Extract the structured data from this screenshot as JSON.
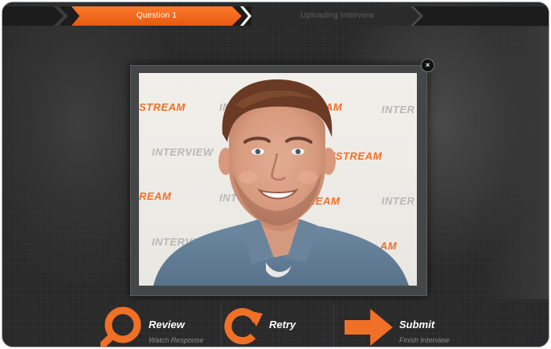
{
  "progress": {
    "steps": [
      {
        "label": "Question 1",
        "state": "active"
      },
      {
        "label": "Uploading Interview",
        "state": "pending"
      }
    ]
  },
  "video": {
    "watermarks": {
      "orange_stream": "STREAM",
      "orange_ream": "REAM",
      "orange_am": "AM",
      "orange_wstream": "WSTREAM",
      "gray_interview": "INTERVIEW",
      "gray_intervi": "INTERVI",
      "gray_inter": "INTER",
      "gray_int": "INT"
    }
  },
  "modal": {
    "close_symbol": "×"
  },
  "actions": {
    "review": {
      "label": "Review",
      "sub": "Watch Response",
      "icon": "magnifier-icon"
    },
    "retry": {
      "label": "Retry",
      "sub": "",
      "icon": "retry-icon"
    },
    "submit": {
      "label": "Submit",
      "sub": "Finish Interview",
      "icon": "arrow-right-icon"
    }
  },
  "colors": {
    "accent": "#f07028",
    "background": "#262626",
    "modal": "#444648"
  }
}
